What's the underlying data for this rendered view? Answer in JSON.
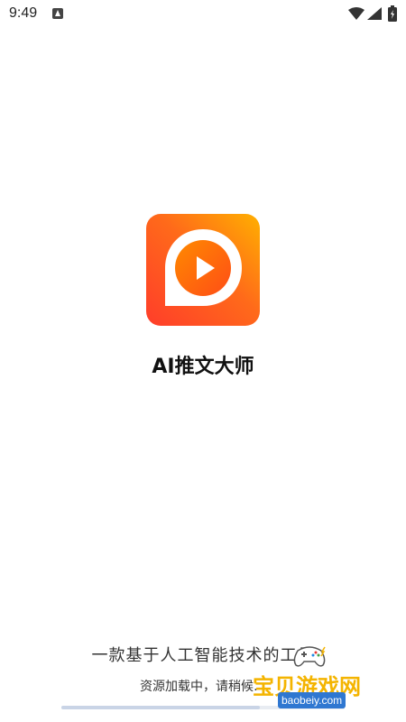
{
  "status_bar": {
    "time": "9:49"
  },
  "app": {
    "name": "AI推文大师"
  },
  "bottom": {
    "slogan": "一款基于人工智能技术的工具",
    "loading_text": "资源加载中，请稍候…",
    "progress": 0.7
  },
  "watermark": {
    "title": "宝贝游戏网",
    "url": "baobeiy.com"
  },
  "colors": {
    "icon_gradient_start": "#ff4b2b",
    "icon_gradient_end": "#ffb000",
    "watermark_blue": "#2f77d1",
    "watermark_gold": "#f4b400"
  }
}
